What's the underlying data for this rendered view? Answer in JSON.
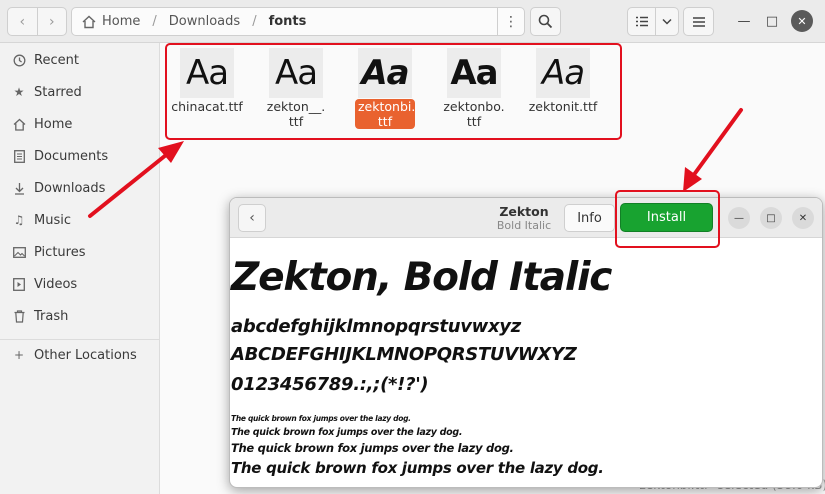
{
  "file_manager": {
    "breadcrumb": {
      "home": "Home",
      "downloads": "Downloads",
      "current": "fonts",
      "separator": "/"
    },
    "sidebar": {
      "items": [
        {
          "label": "Recent",
          "icon": "clock-icon"
        },
        {
          "label": "Starred",
          "icon": "star-icon"
        },
        {
          "label": "Home",
          "icon": "home-icon"
        },
        {
          "label": "Documents",
          "icon": "document-icon"
        },
        {
          "label": "Downloads",
          "icon": "download-icon"
        },
        {
          "label": "Music",
          "icon": "music-icon"
        },
        {
          "label": "Pictures",
          "icon": "picture-icon"
        },
        {
          "label": "Videos",
          "icon": "video-icon"
        },
        {
          "label": "Trash",
          "icon": "trash-icon"
        }
      ],
      "other_locations": "Other Locations"
    },
    "files": [
      {
        "name_line1": "chinacat.ttf",
        "name_line2": "",
        "preview": "Aa",
        "selected": false
      },
      {
        "name_line1": "zekton__.",
        "name_line2": "ttf",
        "preview": "Aa",
        "selected": false
      },
      {
        "name_line1": "zektonbi.",
        "name_line2": "ttf",
        "preview": "Aa",
        "selected": true
      },
      {
        "name_line1": "zektonbo.",
        "name_line2": "ttf",
        "preview": "Aa",
        "selected": false
      },
      {
        "name_line1": "zektonit.ttf",
        "name_line2": "",
        "preview": "Aa",
        "selected": false
      }
    ],
    "status_text": "\"zektonbi.ttf\" selected (58.0 kB)"
  },
  "font_viewer": {
    "title": "Zekton",
    "subtitle": "Bold Italic",
    "info_label": "Info",
    "install_label": "Install",
    "preview": {
      "heading": "Zekton, Bold Italic",
      "lowercase": "abcdefghijklmnopqrstuvwxyz",
      "uppercase": "ABCDEFGHIJKLMNOPQRSTUVWXYZ",
      "digits": "0123456789.:,;(*!?')",
      "sample": "The quick brown fox jumps over the lazy dog."
    }
  },
  "colors": {
    "selection": "#e9622f",
    "install_green": "#18a330",
    "annotation_red": "#e2101e"
  }
}
